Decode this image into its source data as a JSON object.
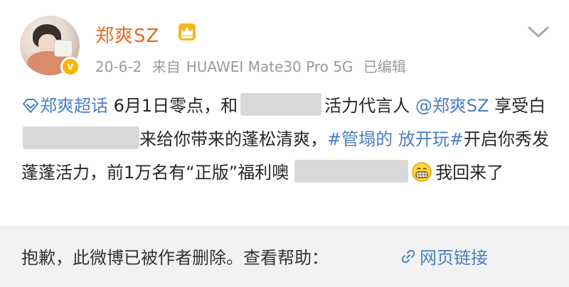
{
  "post": {
    "username": "郑爽SZ",
    "date": "20-6-2",
    "source_prefix": "来自",
    "source_device": "HUAWEI Mate30 Pro 5G",
    "edited": "已编辑",
    "content": {
      "topic_link": "郑爽超话",
      "text1": "  6月1日零点，和",
      "text2": "活力代言人",
      "mention": "@郑爽SZ",
      "text3": " 享受白",
      "text4": "来给你带来的蓬松清爽，",
      "hashtag": "#管塌的 放开玩#",
      "text5": "开启你秀发蓬蓬活力，前1万名有“正版”福利噢",
      "text6": "我回来了"
    }
  },
  "notice": {
    "deleted_text": "抱歉，此微博已被作者删除。查看帮助：",
    "webpage_link_label": "网页链接"
  },
  "colors": {
    "username": "#e86b1f",
    "link": "#4a7fc1",
    "verified_badge": "#f7b500",
    "notice_bg": "#f2f2f2"
  }
}
